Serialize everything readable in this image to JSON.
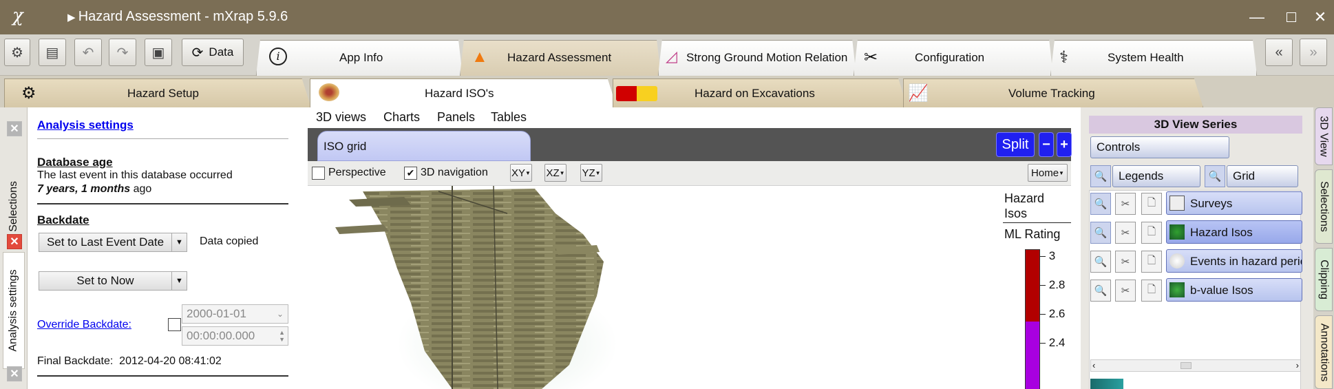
{
  "window": {
    "title": "Hazard Assessment - mXrap 5.9.6",
    "logo": "χ"
  },
  "toolbar": {
    "data_label": "Data",
    "tabs": [
      {
        "label": "App Info",
        "icon": "info-icon"
      },
      {
        "label": "Hazard Assessment",
        "icon": "warning-icon"
      },
      {
        "label": "Strong Ground Motion Relation",
        "icon": "chart-icon"
      },
      {
        "label": "Configuration",
        "icon": "tools-icon"
      },
      {
        "label": "System Health",
        "icon": "stethoscope-icon"
      }
    ],
    "active_tab": "Hazard Assessment"
  },
  "subtabs": [
    {
      "label": "Hazard Setup",
      "icon": "gear-icon"
    },
    {
      "label": "Hazard ISO's",
      "icon": "iso-blob-icon"
    },
    {
      "label": "Hazard on Excavations",
      "icon": "excavation-icon"
    },
    {
      "label": "Volume Tracking",
      "icon": "trend-chart-icon"
    }
  ],
  "active_subtab": "Hazard ISO's",
  "left_vertical_tabs": [
    "All Selections",
    "Analysis settings"
  ],
  "analysis": {
    "heading": "Analysis settings",
    "db_age_title": "Database age",
    "db_age_text": "The last event in this database occurred",
    "db_age_value": "7 years, 1 months",
    "db_age_suffix": "ago",
    "backdate_title": "Backdate",
    "set_last_event": "Set to Last Event Date",
    "data_copied": "Data copied",
    "set_now": "Set to Now",
    "override_label": "Override Backdate:",
    "override_date": "2000-01-01",
    "override_time": "00:00:00.000",
    "final_label": "Final Backdate:",
    "final_value": "2012-04-20 08:41:02"
  },
  "center": {
    "menu": [
      "3D views",
      "Charts",
      "Panels",
      "Tables"
    ],
    "iso_tab": "ISO grid",
    "split": "Split",
    "minus": "−",
    "plus": "+",
    "perspective": "Perspective",
    "nav3d": "3D navigation",
    "perspective_checked": false,
    "nav3d_checked": true,
    "xy": "XY",
    "xz": "XZ",
    "yz": "YZ",
    "home": "Home"
  },
  "legend": {
    "title1": "Hazard",
    "title2": "Isos",
    "subtitle": "ML Rating",
    "ticks": [
      "3",
      "2.8",
      "2.6",
      "2.4"
    ],
    "colors": {
      "high": "#b20000",
      "low": "#a800e0"
    }
  },
  "right_panel": {
    "title": "3D View Series",
    "controls": "Controls",
    "legends": "Legends",
    "grid": "Grid",
    "layers": [
      {
        "label": "Surveys",
        "icon": "survey-mesh-icon"
      },
      {
        "label": "Hazard Isos",
        "icon": "hazard-iso-icon"
      },
      {
        "label": "Events in hazard period",
        "icon": "sphere-icon"
      },
      {
        "label": "b-value Isos",
        "icon": "bvalue-iso-icon"
      }
    ]
  },
  "right_vertical_tabs": [
    "3D View",
    "Selections",
    "Clipping",
    "Annotations"
  ]
}
